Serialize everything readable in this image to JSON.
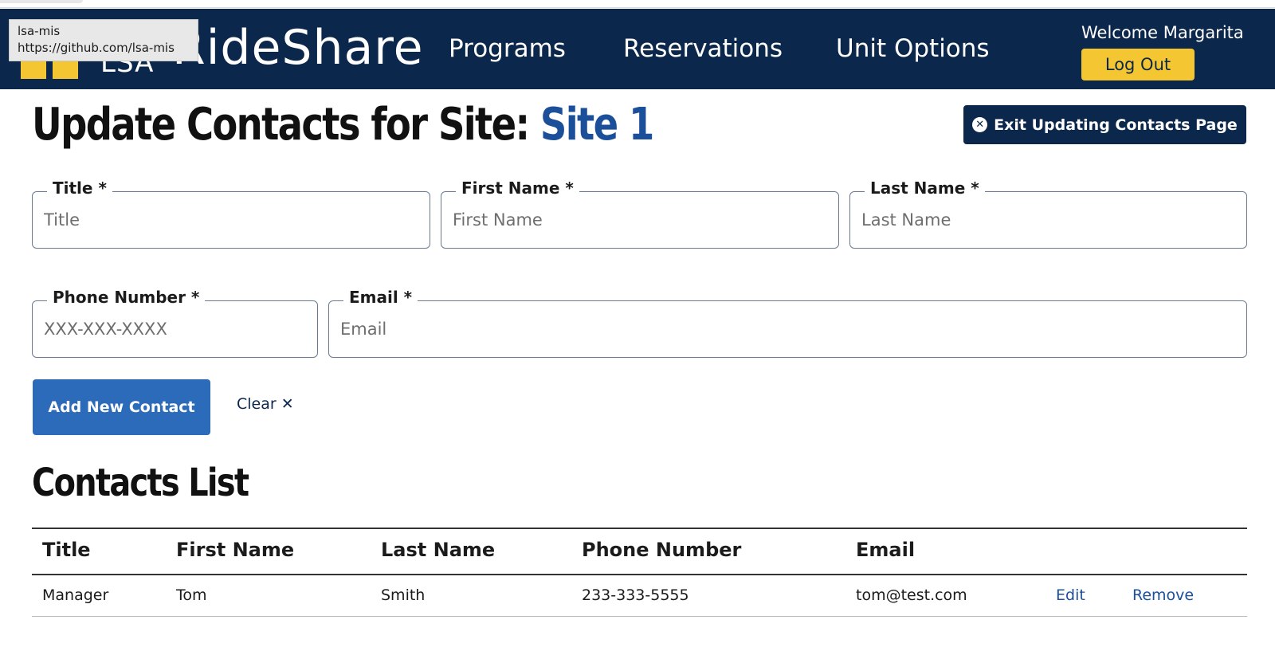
{
  "tooltip": {
    "line1": "lsa-mis",
    "line2": "https://github.com/lsa-mis"
  },
  "header": {
    "logo_text": "LSA",
    "brand": "RideShare",
    "nav": {
      "programs": "Programs",
      "reservations": "Reservations",
      "unit_options": "Unit Options"
    },
    "welcome": "Welcome Margarita",
    "logout": "Log Out",
    "colors": {
      "navy": "#0c274c",
      "maize": "#f4c631"
    }
  },
  "page": {
    "title_prefix": "Update Contacts for Site:",
    "site_name": "Site 1",
    "exit_button": "Exit Updating Contacts Page"
  },
  "form": {
    "title": {
      "label": "Title *",
      "placeholder": "Title",
      "value": ""
    },
    "first_name": {
      "label": "First Name *",
      "placeholder": "First Name",
      "value": ""
    },
    "last_name": {
      "label": "Last Name *",
      "placeholder": "Last Name",
      "value": ""
    },
    "phone": {
      "label": "Phone Number *",
      "placeholder": "XXX-XXX-XXXX",
      "value": ""
    },
    "email": {
      "label": "Email *",
      "placeholder": "Email",
      "value": ""
    },
    "add_button": "Add New Contact",
    "clear_button": "Clear ✕"
  },
  "contacts": {
    "heading": "Contacts List",
    "columns": [
      "Title",
      "First Name",
      "Last Name",
      "Phone Number",
      "Email"
    ],
    "rows": [
      {
        "title": "Manager",
        "first_name": "Tom",
        "last_name": "Smith",
        "phone": "233-333-5555",
        "email": "tom@test.com",
        "edit": "Edit",
        "remove": "Remove"
      }
    ]
  }
}
